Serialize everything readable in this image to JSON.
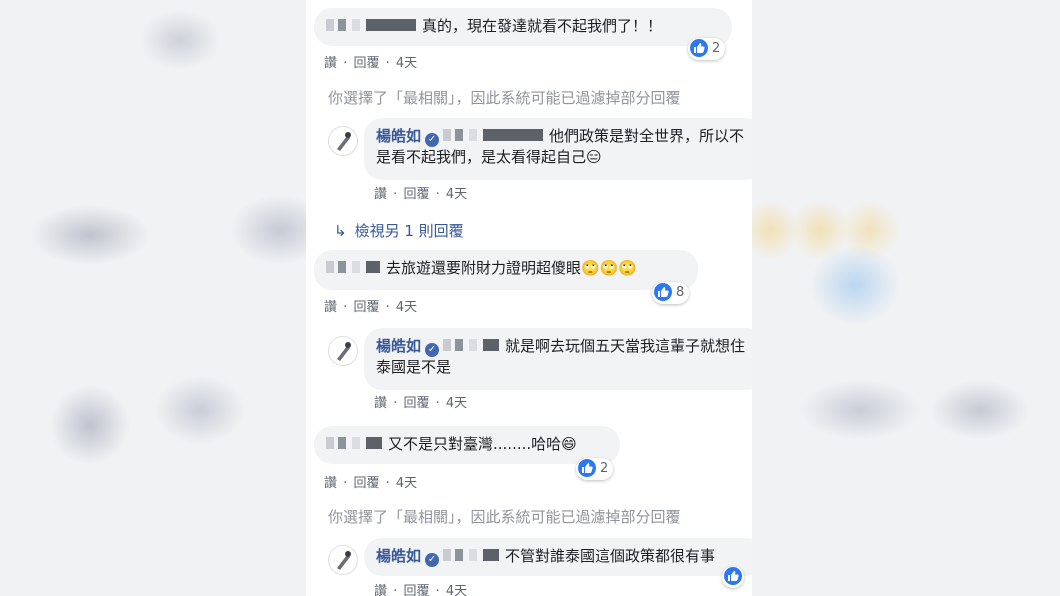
{
  "comments": [
    {
      "text": "真的，現在發達就看不起我們了！！",
      "reactions": "2",
      "actions": {
        "like": "讚",
        "sep": "·",
        "reply": "回覆",
        "time": "4天"
      }
    },
    {
      "filter_note": "你選擇了「最相關」，因此系統可能已過濾掉部分回覆"
    },
    {
      "author": "楊皓如",
      "text": "他們政策是對全世界，所以不是看不起我們，是太看得起自己😑",
      "actions": {
        "like": "讚",
        "sep": "·",
        "reply": "回覆",
        "time": "4天"
      }
    },
    {
      "more_replies": "檢視另 1 則回覆"
    },
    {
      "text": "去旅遊還要附財力證明超傻眼🙄🙄🙄",
      "reactions": "8",
      "actions": {
        "like": "讚",
        "sep": "·",
        "reply": "回覆",
        "time": "4天"
      }
    },
    {
      "author": "楊皓如",
      "text": "就是啊去玩個五天當我這輩子就想住泰國是不是",
      "actions": {
        "like": "讚",
        "sep": "·",
        "reply": "回覆",
        "time": "4天"
      }
    },
    {
      "text": "又不是只對臺灣........哈哈😄",
      "reactions": "2",
      "actions": {
        "like": "讚",
        "sep": "·",
        "reply": "回覆",
        "time": "4天"
      }
    },
    {
      "filter_note": "你選擇了「最相關」，因此系統可能已過濾掉部分回覆"
    },
    {
      "author": "楊皓如",
      "text": "不管對誰泰國這個政策都很有事",
      "actions": {
        "like": "讚",
        "sep": "·",
        "reply": "回覆",
        "time": "4天"
      }
    }
  ],
  "icons": {
    "like": "like-icon",
    "verified": "verified-badge-icon",
    "reply_arrow": "reply-arrow-icon"
  },
  "colors": {
    "link": "#385898",
    "bubble": "#f2f3f5",
    "like": "#2e77f2"
  }
}
